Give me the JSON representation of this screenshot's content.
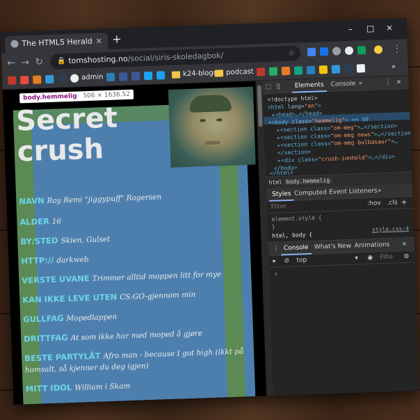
{
  "browser": {
    "tab_title": "The HTML5 Herald",
    "url_host": "tomshosting.no",
    "url_path": "/social/siris-skoledagbok/",
    "new_tab": "+",
    "close_tab": "×",
    "bookmarks": {
      "admin": "admin",
      "k24": "k24-blogg",
      "podcast": "podcast"
    },
    "window_controls": {
      "minimize": "–",
      "maximize": "□",
      "close": "×"
    }
  },
  "page": {
    "tooltip": {
      "selector": "body.hemmelig",
      "size": "506 × 1636.52"
    },
    "headline_1": "Secret",
    "headline_2": "crush",
    "fields": [
      {
        "key": "NAVN",
        "value": "Roy Remi \"jiggypuff\" Rogersen"
      },
      {
        "key": "ALDER",
        "value": "16"
      },
      {
        "key": "BY/STED",
        "value": "Skien, Gulset"
      },
      {
        "key": "HTTP://",
        "value": "darkweb"
      },
      {
        "key": "VERSTE UVANE",
        "value": "Trimmer alltid moppen litt for mye"
      },
      {
        "key": "KAN IKKE LEVE UTEN",
        "value": "CS:GO-gjennom min"
      },
      {
        "key": "GULLFAG",
        "value": "Mopedlappen"
      },
      {
        "key": "DRITTFAG",
        "value": "At som ikke har med moped å gjøre"
      },
      {
        "key": "BESTE PARTYLÅT",
        "value": "Afro man - because I got high (ikkt på homsalt, så kjenner du deg igjen)"
      },
      {
        "key": "MITT IDOL",
        "value": "William i Skam"
      }
    ]
  },
  "devtools": {
    "tabs": {
      "elements": "Elements",
      "console": "Console",
      "more": "»"
    },
    "dom": {
      "l1": "<!doctype html>",
      "l2_tag": "<html ",
      "l2_attr": "lang=",
      "l2_val": "\"en\"",
      "l2_end": ">",
      "l3": "▸<head>…</head>",
      "l4_tag": "▾<body ",
      "l4_attr": "class=",
      "l4_val": "\"hemmelig\"",
      "l4_end": "> == $0",
      "l5_a": "▸<section class=",
      "l5_v": "\"om-meg\"",
      "l5_e": ">…</section>",
      "l6_a": "▸<section class=",
      "l6_v": "\"om-meg news\"",
      "l6_e": ">…</section>",
      "l7_a": "▸<section class=",
      "l7_v": "\"om-meg bulbasaur\"",
      "l7_e": ">…",
      "l8": "</section>",
      "l9_a": "▸<div class=",
      "l9_v": "\"crush-innhold\"",
      "l9_e": ">…</div>",
      "l10": "</body>",
      "l11": "</html>"
    },
    "breadcrumbs": {
      "html": "html",
      "body": "body.hemmelig"
    },
    "subtabs": {
      "styles": "Styles",
      "computed": "Computed",
      "listeners": "Event Listeners",
      "more": "»"
    },
    "filter": {
      "placeholder": "Filter",
      "hov": ":hov",
      "cls": ".cls",
      "add": "+"
    },
    "styles": {
      "element_style": "element.style {",
      "close": "}",
      "rule": "html, body {",
      "source": "style.css:4"
    },
    "drawer": {
      "console": "Console",
      "whats_new": "What's New",
      "animations": "Animations",
      "context": "top",
      "filter": "Filte"
    }
  }
}
